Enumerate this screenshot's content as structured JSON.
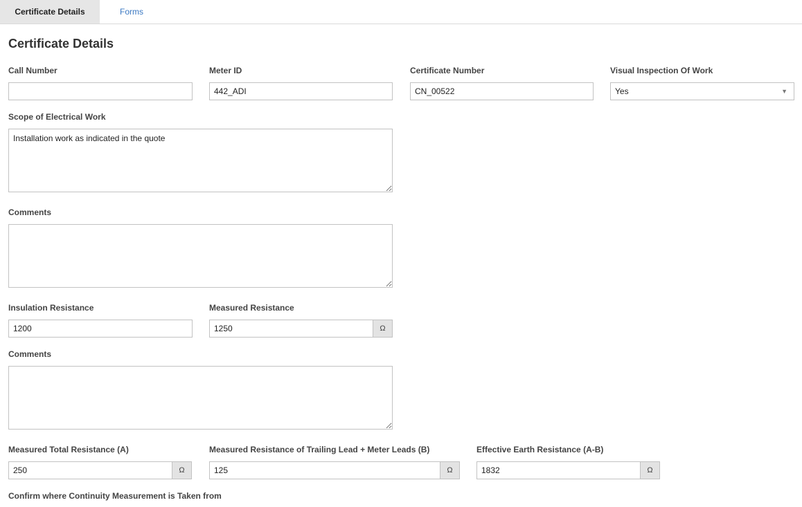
{
  "tabs": [
    {
      "label": "Certificate Details"
    },
    {
      "label": "Forms"
    }
  ],
  "page_title": "Certificate Details",
  "fields": {
    "call_number": {
      "label": "Call Number",
      "value": ""
    },
    "meter_id": {
      "label": "Meter ID",
      "value": "442_ADI"
    },
    "certificate_number": {
      "label": "Certificate Number",
      "value": "CN_00522"
    },
    "visual_inspection": {
      "label": "Visual Inspection Of Work",
      "value": "Yes"
    },
    "scope": {
      "label": "Scope of Electrical Work",
      "value": "Installation work as indicated in the quote"
    },
    "comments_1": {
      "label": "Comments",
      "value": ""
    },
    "insulation_resistance": {
      "label": "Insulation Resistance",
      "value": "1200"
    },
    "measured_resistance": {
      "label": "Measured Resistance",
      "value": "1250",
      "unit": "Ω"
    },
    "comments_2": {
      "label": "Comments",
      "value": ""
    },
    "measured_total_resistance": {
      "label": "Measured Total Resistance (A)",
      "value": "250",
      "unit": "Ω"
    },
    "trailing_lead_resistance": {
      "label": "Measured Resistance of Trailing Lead + Meter Leads (B)",
      "value": "125",
      "unit": "Ω"
    },
    "effective_earth_resistance": {
      "label": "Effective Earth Resistance (A-B)",
      "value": "1832",
      "unit": "Ω"
    },
    "continuity_confirm": {
      "label": "Confirm where Continuity Measurement is Taken from"
    }
  },
  "colors": {
    "tab_active_bg": "#e6e6e6",
    "tab_link": "#3a78c2",
    "addon_bg": "#e3e3e3",
    "border": "#c2c2c2"
  }
}
